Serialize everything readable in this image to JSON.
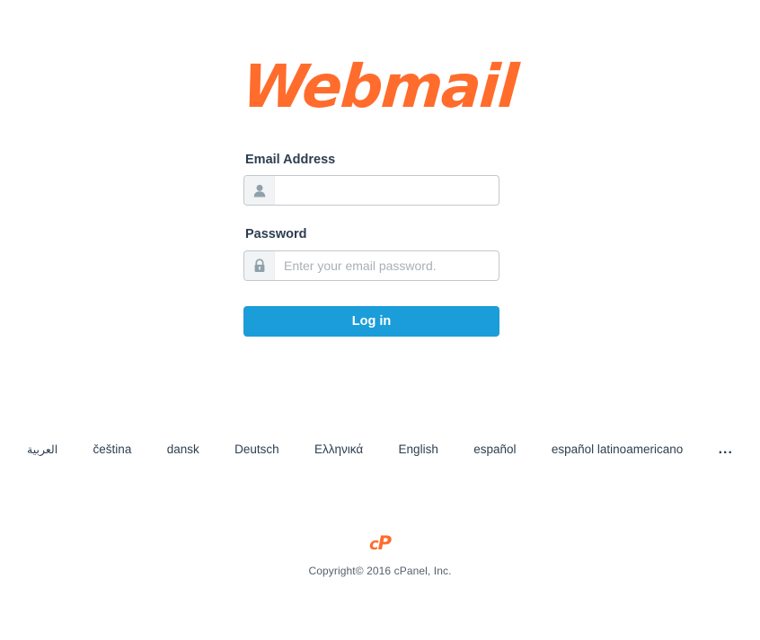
{
  "brand": {
    "logo_text": "Webmail",
    "logo_color": "#ff6c2c",
    "accent_color": "#1b9dd9"
  },
  "form": {
    "email": {
      "label": "Email Address",
      "value": "",
      "placeholder": "",
      "icon": "user-icon"
    },
    "password": {
      "label": "Password",
      "value": "",
      "placeholder": "Enter your email password.",
      "icon": "lock-icon"
    },
    "submit_label": "Log in"
  },
  "languages": {
    "items": [
      {
        "label": "العربية",
        "rtl": true
      },
      {
        "label": "čeština",
        "rtl": false
      },
      {
        "label": "dansk",
        "rtl": false
      },
      {
        "label": "Deutsch",
        "rtl": false
      },
      {
        "label": "Ελληνικά",
        "rtl": false
      },
      {
        "label": "English",
        "rtl": false
      },
      {
        "label": "español",
        "rtl": false
      },
      {
        "label": "español latinoamericano",
        "rtl": false
      }
    ],
    "more_label": "..."
  },
  "footer": {
    "cpanel_logo_c": "c",
    "cpanel_logo_p": "P",
    "copyright": "Copyright© 2016 cPanel, Inc."
  }
}
